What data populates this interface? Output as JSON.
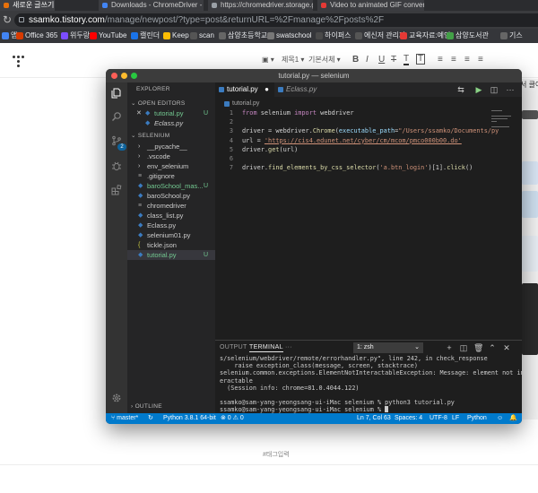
{
  "browser": {
    "tabs": [
      {
        "label": "새로운 글쓰기"
      },
      {
        "label": "Downloads - ChromeDriver - Web"
      },
      {
        "label": "https://chromedriver.storage.go"
      },
      {
        "label": "Video to animated GIF converter"
      }
    ],
    "url_host": "ssamko.tistory.com",
    "url_path": "/manage/newpost/?type=post&returnURL=%2Fmanage%2Fposts%2F",
    "bookmarks": [
      {
        "label": "앱",
        "color": "#4285f4"
      },
      {
        "label": "Office 365",
        "color": "#d83b01"
      },
      {
        "label": "위두랑",
        "color": "#7c4dff"
      },
      {
        "label": "YouTube",
        "color": "#ff0000"
      },
      {
        "label": "캘린더",
        "color": "#1a73e8"
      },
      {
        "label": "Keep",
        "color": "#fbbc04"
      },
      {
        "label": "scan",
        "color": "#555555"
      },
      {
        "label": "삼양초등학교",
        "color": "#666666"
      },
      {
        "label": "swatschool",
        "color": "#777777"
      },
      {
        "label": "하이퍼스",
        "color": "#4a4a4a"
      },
      {
        "label": "에신저 관리자",
        "color": "#555555"
      },
      {
        "label": "교육자료:예인",
        "color": "#e53935"
      },
      {
        "label": "삼양도서관",
        "color": "#43a047"
      },
      {
        "label": "기스",
        "color": "#666666"
      }
    ]
  },
  "blog_editor": {
    "toolbar": {
      "image_label": "▣ ▾",
      "heading_label": "제목1 ▾",
      "font_label": "기본서체 ▾",
      "bold": "B",
      "italic": "I",
      "underline": "U",
      "strike": "T",
      "textcolor": "T",
      "bgcolor": "T",
      "align_left": "≡",
      "align_center": "≡",
      "align_right": "≡",
      "align_justify": "≡"
    },
    "tag_placeholder": "#태그입력",
    "peek_text": "서 클어"
  },
  "vscode": {
    "window_title": "tutorial.py — selenium",
    "explorer_title": "EXPLORER",
    "open_editors_title": "OPEN EDITORS",
    "open_editors": [
      {
        "name": "tutorial.py",
        "close": "✕",
        "status": "U"
      },
      {
        "name": "Eclass.py"
      }
    ],
    "folder_title": "SELENIUM",
    "files": [
      {
        "name": "__pycache__",
        "kind": "folder"
      },
      {
        "name": ".vscode",
        "kind": "folder"
      },
      {
        "name": "env_selenium",
        "kind": "folder"
      },
      {
        "name": ".gitignore",
        "kind": "file"
      },
      {
        "name": "baroSchool_mas...",
        "kind": "py",
        "status": "U"
      },
      {
        "name": "baroSchool.py",
        "kind": "py"
      },
      {
        "name": "chromedriver",
        "kind": "file"
      },
      {
        "name": "class_list.py",
        "kind": "py"
      },
      {
        "name": "Eclass.py",
        "kind": "py"
      },
      {
        "name": "selenium01.py",
        "kind": "py"
      },
      {
        "name": "tickle.json",
        "kind": "json"
      },
      {
        "name": "tutorial.py",
        "kind": "py",
        "status": "U"
      }
    ],
    "outline_title": "OUTLINE",
    "editor_tabs": [
      {
        "label": "tutorial.py",
        "active": true
      },
      {
        "label": "Eclass.py",
        "active": false
      }
    ],
    "breadcrumb": "tutorial.py",
    "code_lines": [
      {
        "n": "1",
        "parts": [
          {
            "t": "from",
            "c": "kw"
          },
          {
            "t": " selenium ",
            "c": ""
          },
          {
            "t": "import",
            "c": "kw"
          },
          {
            "t": " webdriver",
            "c": ""
          }
        ]
      },
      {
        "n": "2",
        "parts": []
      },
      {
        "n": "3",
        "parts": [
          {
            "t": "driver = webdriver.",
            "c": ""
          },
          {
            "t": "Chrome",
            "c": "fn"
          },
          {
            "t": "(",
            "c": ""
          },
          {
            "t": "executable_path",
            "c": "prm"
          },
          {
            "t": "=",
            "c": ""
          },
          {
            "t": "\"/Users/ssamko/Documents/py",
            "c": "str"
          }
        ]
      },
      {
        "n": "4",
        "parts": [
          {
            "t": "url = ",
            "c": ""
          },
          {
            "t": "'https://cis4.edunet.net/cyber/cm/mcom/pmco000b00.do'",
            "c": "link"
          }
        ]
      },
      {
        "n": "5",
        "parts": [
          {
            "t": "driver.",
            "c": ""
          },
          {
            "t": "get",
            "c": "fn"
          },
          {
            "t": "(url)",
            "c": ""
          }
        ]
      },
      {
        "n": "6",
        "parts": []
      },
      {
        "n": "7",
        "parts": [
          {
            "t": "driver.",
            "c": ""
          },
          {
            "t": "find_elements_by_css_selector",
            "c": "fn"
          },
          {
            "t": "(",
            "c": ""
          },
          {
            "t": "'a.btn_login'",
            "c": "str"
          },
          {
            "t": ")[1].",
            "c": ""
          },
          {
            "t": "click",
            "c": "fn"
          },
          {
            "t": "()",
            "c": ""
          }
        ]
      }
    ],
    "panel": {
      "tabs": [
        "OUTPUT",
        "TERMINAL",
        "···"
      ],
      "terminal_select": "1: zsh",
      "lines": [
        "s/selenium/webdriver/remote/errorhandler.py\", line 242, in check_response",
        "    raise exception_class(message, screen, stacktrace)",
        "selenium.common.exceptions.ElementNotInteractableException: Message: element not int",
        "eractable",
        "  (Session info: chrome=81.0.4044.122)",
        "",
        "ssamko@sam-yang-yeongsang-ui-iMac selenium % python3 tutorial.py",
        "ssamko@sam-yang-yeongsang-ui-iMac selenium % "
      ]
    },
    "status": {
      "branch": "master*",
      "python": "Python 3.8.1 64-bit",
      "problems": "⊗ 0 ⚠ 0",
      "position": "Ln 7, Col 63",
      "spaces": "Spaces: 4",
      "encoding": "UTF-8",
      "eol": "LF",
      "language": "Python"
    },
    "colors": {
      "statusbar": "#007acc",
      "accent_untracked": "#73c991",
      "python_file": "#3b7bbf"
    }
  }
}
